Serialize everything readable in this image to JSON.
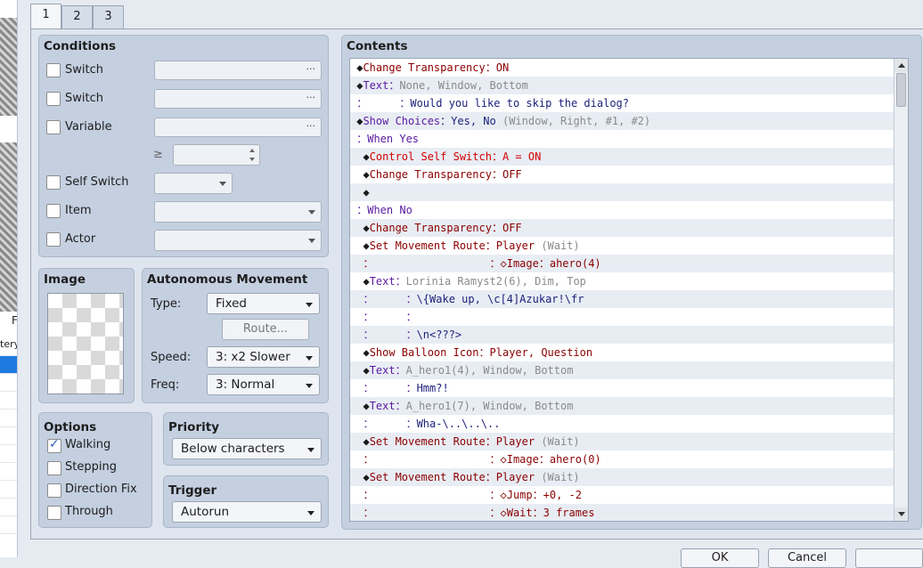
{
  "tabs": [
    "1",
    "2",
    "3"
  ],
  "conditions": {
    "title": "Conditions",
    "switch1_label": "Switch",
    "switch2_label": "Switch",
    "variable_label": "Variable",
    "dots": "···",
    "ge_symbol": "≥",
    "self_switch_label": "Self Switch",
    "item_label": "Item",
    "actor_label": "Actor"
  },
  "image": {
    "title": "Image"
  },
  "autonomous": {
    "title": "Autonomous Movement",
    "type_label": "Type:",
    "type_value": "Fixed",
    "route_button": "Route...",
    "speed_label": "Speed:",
    "speed_value": "3: x2 Slower",
    "freq_label": "Freq:",
    "freq_value": "3: Normal"
  },
  "options": {
    "title": "Options",
    "walking": "Walking",
    "stepping": "Stepping",
    "direction_fix": "Direction Fix",
    "through": "Through"
  },
  "priority": {
    "title": "Priority",
    "value": "Below characters"
  },
  "trigger": {
    "title": "Trigger",
    "value": "Autorun"
  },
  "contents": {
    "title": "Contents",
    "lines": [
      [
        {
          "t": " ◆",
          "c": "c-dark"
        },
        {
          "t": "Change Transparency",
          "c": "c-red"
        },
        {
          "t": "：ON",
          "c": "c-red"
        }
      ],
      [
        {
          "t": " ◆",
          "c": "c-dark"
        },
        {
          "t": "Text",
          "c": "c-purple"
        },
        {
          "t": "：",
          "c": "c-purple"
        },
        {
          "t": "None, Window, Bottom",
          "c": "c-gray"
        }
      ],
      [
        {
          "t": " ：     ：",
          "c": "c-purple"
        },
        {
          "t": "Would you like to skip the dialog?",
          "c": "c-navy"
        }
      ],
      [
        {
          "t": " ◆",
          "c": "c-dark"
        },
        {
          "t": "Show Choices",
          "c": "c-purple"
        },
        {
          "t": "：Yes, No ",
          "c": "c-navy"
        },
        {
          "t": "(Window, Right, #1, #2)",
          "c": "c-gray"
        }
      ],
      [
        {
          "t": " ：",
          "c": "c-purple"
        },
        {
          "t": "When Yes",
          "c": "c-purple"
        }
      ],
      [
        {
          "t": "  ◆",
          "c": "c-dark"
        },
        {
          "t": "Control Self Switch",
          "c": "c-brightred"
        },
        {
          "t": "：A = ON",
          "c": "c-brightred"
        }
      ],
      [
        {
          "t": "  ◆",
          "c": "c-dark"
        },
        {
          "t": "Change Transparency",
          "c": "c-red"
        },
        {
          "t": "：OFF",
          "c": "c-red"
        }
      ],
      [
        {
          "t": "  ◆",
          "c": "c-dark"
        }
      ],
      [
        {
          "t": " ：",
          "c": "c-purple"
        },
        {
          "t": "When No",
          "c": "c-purple"
        }
      ],
      [
        {
          "t": "  ◆",
          "c": "c-dark"
        },
        {
          "t": "Change Transparency",
          "c": "c-red"
        },
        {
          "t": "：OFF",
          "c": "c-red"
        }
      ],
      [
        {
          "t": "  ◆",
          "c": "c-dark"
        },
        {
          "t": "Set Movement Route",
          "c": "c-red"
        },
        {
          "t": "：Player ",
          "c": "c-red"
        },
        {
          "t": "(Wait)",
          "c": "c-gray"
        }
      ],
      [
        {
          "t": "  ：                  ：◇Image：ahero(4)",
          "c": "c-red"
        }
      ],
      [
        {
          "t": "  ◆",
          "c": "c-dark"
        },
        {
          "t": "Text",
          "c": "c-purple"
        },
        {
          "t": "：",
          "c": "c-purple"
        },
        {
          "t": "Lorinia Ramyst2(6), Dim, Top",
          "c": "c-gray"
        }
      ],
      [
        {
          "t": "  ：     ：",
          "c": "c-purple"
        },
        {
          "t": "\\{Wake up, \\c[4]Azukar!\\fr",
          "c": "c-navy"
        }
      ],
      [
        {
          "t": "  ：     ：",
          "c": "c-purple"
        }
      ],
      [
        {
          "t": "  ：     ：",
          "c": "c-purple"
        },
        {
          "t": "\\n<???>",
          "c": "c-navy"
        }
      ],
      [
        {
          "t": "  ◆",
          "c": "c-dark"
        },
        {
          "t": "Show Balloon Icon",
          "c": "c-red"
        },
        {
          "t": "：Player, Question",
          "c": "c-red"
        }
      ],
      [
        {
          "t": "  ◆",
          "c": "c-dark"
        },
        {
          "t": "Text",
          "c": "c-purple"
        },
        {
          "t": "：",
          "c": "c-purple"
        },
        {
          "t": "A_hero1(4), Window, Bottom",
          "c": "c-gray"
        }
      ],
      [
        {
          "t": "  ：     ：",
          "c": "c-purple"
        },
        {
          "t": "Hmm?!",
          "c": "c-navy"
        }
      ],
      [
        {
          "t": "  ◆",
          "c": "c-dark"
        },
        {
          "t": "Text",
          "c": "c-purple"
        },
        {
          "t": "：",
          "c": "c-purple"
        },
        {
          "t": "A_hero1(7), Window, Bottom",
          "c": "c-gray"
        }
      ],
      [
        {
          "t": "  ：     ：",
          "c": "c-purple"
        },
        {
          "t": "Wha-\\..\\..\\..",
          "c": "c-navy"
        }
      ],
      [
        {
          "t": "  ◆",
          "c": "c-dark"
        },
        {
          "t": "Set Movement Route",
          "c": "c-red"
        },
        {
          "t": "：Player ",
          "c": "c-red"
        },
        {
          "t": "(Wait)",
          "c": "c-gray"
        }
      ],
      [
        {
          "t": "  ：                  ：◇Image：ahero(0)",
          "c": "c-red"
        }
      ],
      [
        {
          "t": "  ◆",
          "c": "c-dark"
        },
        {
          "t": "Set Movement Route",
          "c": "c-red"
        },
        {
          "t": "：Player ",
          "c": "c-red"
        },
        {
          "t": "(Wait)",
          "c": "c-gray"
        }
      ],
      [
        {
          "t": "  ：                  ：◇Jump：+0, -2",
          "c": "c-red"
        }
      ],
      [
        {
          "t": "  ：                  ：◇Wait：3 frames",
          "c": "c-red"
        }
      ]
    ]
  },
  "footer": {
    "ok": "OK",
    "cancel": "Cancel"
  },
  "left_strip": {
    "fragment_p": "F",
    "fragment_ter": "tery"
  }
}
